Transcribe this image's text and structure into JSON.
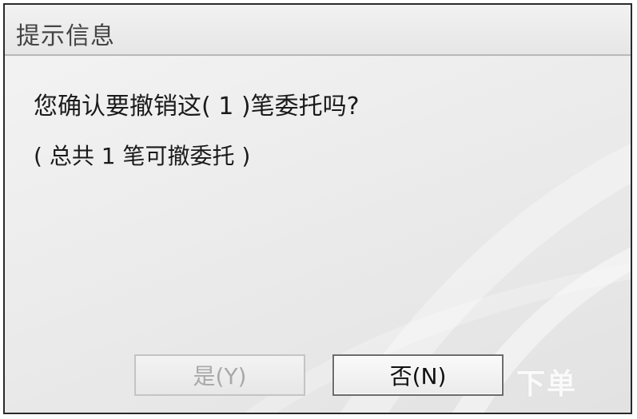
{
  "dialog": {
    "title": "提示信息",
    "message": "您确认要撤销这( 1 )笔委托吗?",
    "sub_message": "( 总共 1 笔可撤委托 )",
    "buttons": {
      "yes_label": "是(Y)",
      "no_label": "否(N)"
    },
    "watermark": "下单"
  },
  "colors": {
    "title_text": "#444444",
    "disabled_text": "#a9a9a9",
    "border": "#2a2a2a"
  }
}
